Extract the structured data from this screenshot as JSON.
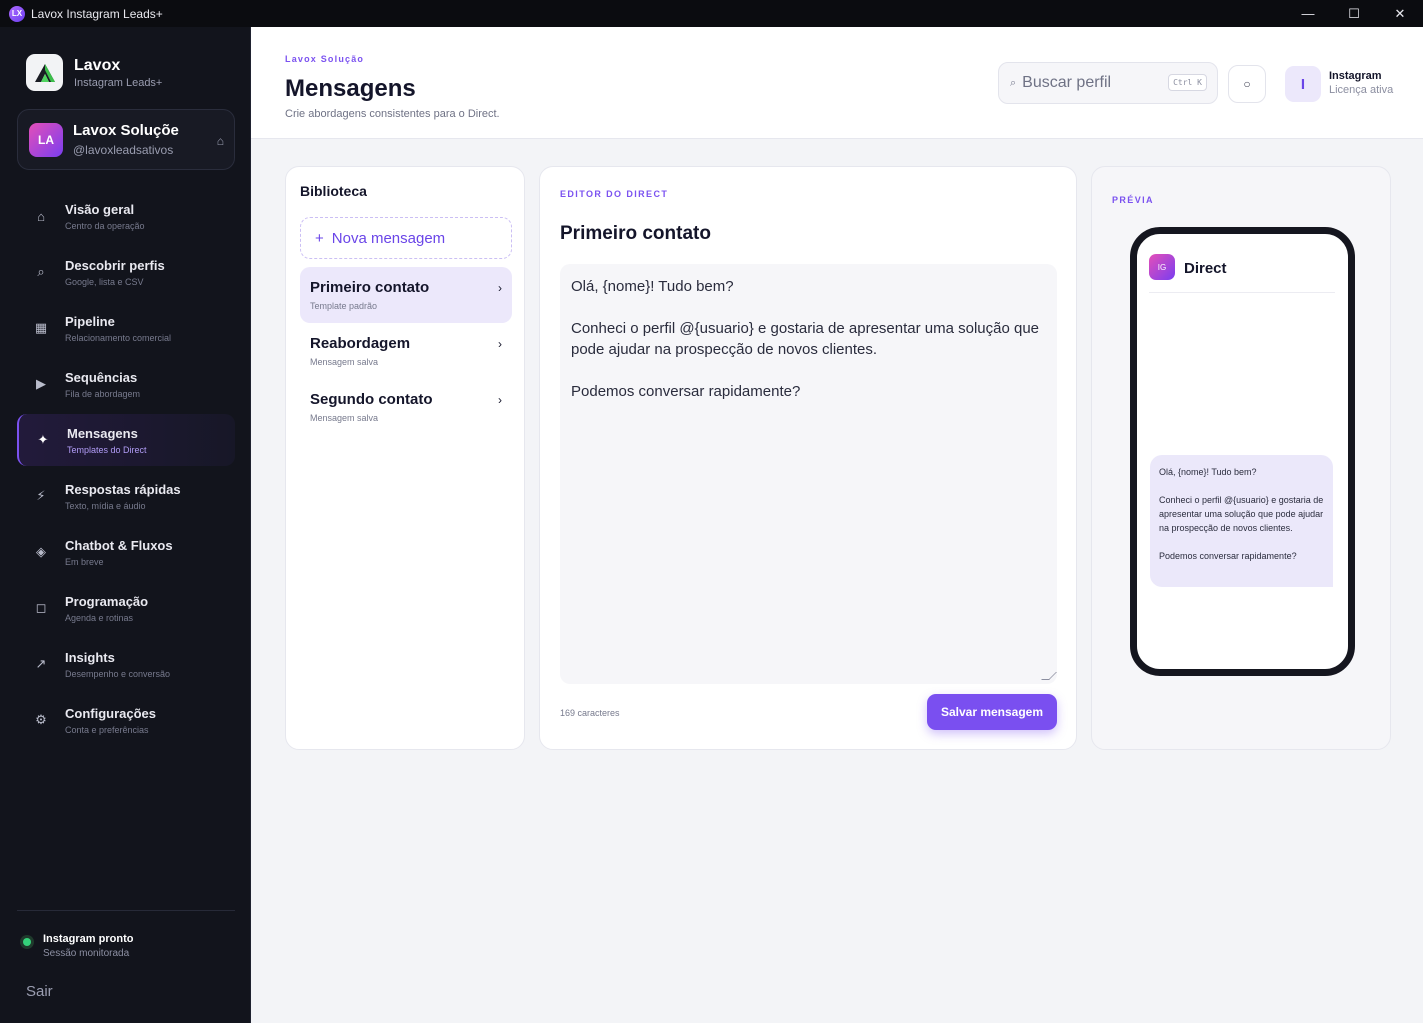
{
  "window": {
    "title": "Lavox Instagram Leads+",
    "app_icon_text": "LX",
    "minimize": "—",
    "maximize": "☐",
    "close": "✕"
  },
  "sidebar": {
    "brand_name": "Lavox",
    "brand_sub": "Instagram Leads+",
    "account": {
      "initials": "LA",
      "name": "Lavox Soluçõe",
      "handle": "@lavoxleadsativos"
    },
    "items": [
      {
        "icon": "⌂",
        "label": "Visão geral",
        "sub": "Centro da operação"
      },
      {
        "icon": "⌕",
        "label": "Descobrir perfis",
        "sub": "Google, lista e CSV"
      },
      {
        "icon": "▦",
        "label": "Pipeline",
        "sub": "Relacionamento comercial"
      },
      {
        "icon": "▶",
        "label": "Sequências",
        "sub": "Fila de abordagem"
      },
      {
        "icon": "✦",
        "label": "Mensagens",
        "sub": "Templates do Direct"
      },
      {
        "icon": "⚡",
        "label": "Respostas rápidas",
        "sub": "Texto, mídia e áudio"
      },
      {
        "icon": "◈",
        "label": "Chatbot & Fluxos",
        "sub": "Em breve"
      },
      {
        "icon": "◻",
        "label": "Programação",
        "sub": "Agenda e rotinas"
      },
      {
        "icon": "↗",
        "label": "Insights",
        "sub": "Desempenho e conversão"
      },
      {
        "icon": "⚙",
        "label": "Configurações",
        "sub": "Conta e preferências"
      }
    ],
    "active_index": 4,
    "status_title": "Instagram pronto",
    "status_sub": "Sessão monitorada",
    "logout": "Sair"
  },
  "header": {
    "eyebrow": "Lavox Solução",
    "title": "Mensagens",
    "subtitle": "Crie abordagens consistentes para o Direct.",
    "search_placeholder": "Buscar perfil",
    "search_shortcut": "Ctrl K",
    "license_initial": "I",
    "license_title": "Instagram",
    "license_sub": "Licença ativa"
  },
  "library": {
    "title": "Biblioteca",
    "new_label": "Nova mensagem",
    "templates": [
      {
        "name": "Primeiro contato",
        "sub": "Template padrão"
      },
      {
        "name": "Reabordagem",
        "sub": "Mensagem salva"
      },
      {
        "name": "Segundo contato",
        "sub": "Mensagem salva"
      }
    ]
  },
  "editor": {
    "eyebrow": "EDITOR DO DIRECT",
    "title": "Primeiro contato",
    "message": "Olá, {nome}! Tudo bem?\n\nConheci o perfil @{usuario} e gostaria de apresentar uma solução que pode ajudar na prospecção de novos clientes.\n\nPodemos conversar rapidamente?",
    "char_count": "169 caracteres",
    "save_label": "Salvar mensagem"
  },
  "preview": {
    "eyebrow": "PRÉVIA",
    "app_badge": "IG",
    "app_title": "Direct",
    "bubble": "Olá, {nome}! Tudo bem?\n\nConheci o perfil @{usuario} e gostaria de apresentar uma solução que pode ajudar na prospecção de novos clientes.\n\nPodemos conversar rapidamente?"
  },
  "colors": {
    "accent": "#7a4ff0",
    "sidebar_bg": "#12141c",
    "status_ok": "#34d27a"
  }
}
